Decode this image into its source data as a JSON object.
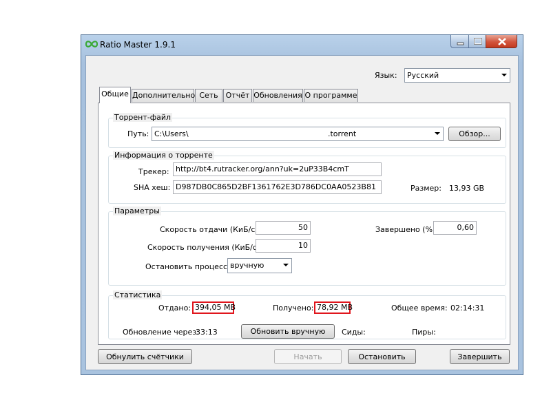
{
  "window": {
    "title": "Ratio Master 1.9.1"
  },
  "language": {
    "label": "Язык:",
    "value": "Русский"
  },
  "tabs": [
    {
      "label": "Общие"
    },
    {
      "label": "Дополнительно"
    },
    {
      "label": "Сеть"
    },
    {
      "label": "Отчёт"
    },
    {
      "label": "Обновления"
    },
    {
      "label": "О программе"
    }
  ],
  "torrent_file": {
    "group_title": "Торрент-файл",
    "path_label": "Путь:",
    "path_value": "C:\\Users\\",
    "path_suffix": ".torrent",
    "browse_label": "Обзор..."
  },
  "torrent_info": {
    "group_title": "Информация о торренте",
    "tracker_label": "Трекер:",
    "tracker_value": "http://bt4.rutracker.org/ann?uk=2uP33B4cmT",
    "sha_label": "SHA хеш:",
    "sha_value": "D987DB0C865D2BF1361762E3D786DC0AA0523B81",
    "size_label": "Размер:",
    "size_value": "13,93 GB"
  },
  "params": {
    "group_title": "Параметры",
    "upload_label": "Скорость отдачи (КиБ/с):",
    "upload_value": "50",
    "download_label": "Скорость получения (КиБ/с):",
    "download_value": "10",
    "completed_label": "Завершено (%)",
    "completed_value": "0,60",
    "stop_label": "Остановить процесс",
    "stop_value": "вручную"
  },
  "stats": {
    "group_title": "Статистика",
    "uploaded_label": "Отдано:",
    "uploaded_value": "394,05 MB",
    "downloaded_label": "Получено:",
    "downloaded_value": "78,92 MB",
    "total_time_label": "Общее время:",
    "total_time_value": "02:14:31",
    "update_label": "Обновление через:",
    "update_value": "33:13",
    "update_button": "Обновить вручную",
    "seeds_label": "Сиды:",
    "peers_label": "Пиры:"
  },
  "footer": {
    "reset_button": "Обнулить счётчики",
    "start_button": "Начать",
    "stop_button": "Остановить",
    "finish_button": "Завершить"
  },
  "colors": {
    "highlight": "#e0161d",
    "window_frame": "#a9c3df",
    "close_button": "#c23a1f"
  }
}
